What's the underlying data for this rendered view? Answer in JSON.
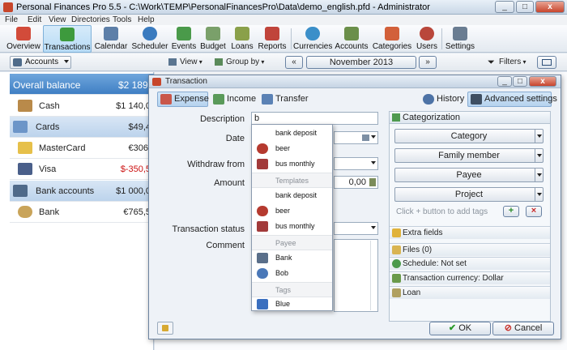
{
  "window": {
    "title": "Personal Finances Pro 5.5 - C:\\Work\\TEMP\\PersonalFinancesPro\\Data\\demo_english.pfd - Administrator",
    "min": "_",
    "max": "□",
    "close": "x"
  },
  "menu": [
    "File",
    "Edit",
    "View",
    "Directories",
    "Tools",
    "Help"
  ],
  "toolbar": [
    {
      "label": "Overview",
      "icon": "calendar-overview-icon",
      "color": "#d24b3a"
    },
    {
      "label": "Transactions",
      "icon": "transactions-book-icon",
      "color": "#3d9a3d"
    },
    {
      "label": "Calendar",
      "icon": "calendar-icon",
      "color": "#5d7fa8"
    },
    {
      "label": "Scheduler",
      "icon": "scheduler-clock-icon",
      "color": "#3a7bbf"
    },
    {
      "label": "Events",
      "icon": "events-check-icon",
      "color": "#4a9a4a"
    },
    {
      "label": "Budget",
      "icon": "budget-envelope-icon",
      "color": "#7aa06a"
    },
    {
      "label": "Loans",
      "icon": "loans-money-icon",
      "color": "#8aa04a"
    },
    {
      "label": "Reports",
      "icon": "reports-chart-icon",
      "color": "#c0443b"
    },
    {
      "label": "Currencies",
      "icon": "currencies-exchange-icon",
      "color": "#3b8fc9"
    },
    {
      "label": "Accounts",
      "icon": "accounts-cash-icon",
      "color": "#6b8f4a"
    },
    {
      "label": "Categories",
      "icon": "categories-tree-icon",
      "color": "#d2603a"
    },
    {
      "label": "Users",
      "icon": "users-icon",
      "color": "#b9473b"
    },
    {
      "label": "Settings",
      "icon": "settings-icon",
      "color": "#6a7d92"
    }
  ],
  "toolbar2": {
    "accounts": "Accounts",
    "view": "View",
    "group_by": "Group by",
    "period": "November 2013",
    "filters": "Filters"
  },
  "accounts": [
    {
      "name": "Overall balance",
      "amount": "$2 189,",
      "kind": "total"
    },
    {
      "name": "Cash",
      "amount": "$1 140,0",
      "kind": "item",
      "icon": "cash-box-icon",
      "color": "#b98a4a"
    },
    {
      "name": "Cards",
      "amount": "$49,4",
      "kind": "group",
      "icon": "cards-group-icon",
      "color": "#6c95c8"
    },
    {
      "name": "MasterCard",
      "amount": "€306,",
      "kind": "item",
      "icon": "mastercard-icon",
      "color": "#e6c04a"
    },
    {
      "name": "Visa",
      "amount": "$-350,5",
      "kind": "item",
      "negative": true,
      "icon": "visa-card-icon",
      "color": "#4a5f8a"
    },
    {
      "name": "Bank accounts",
      "amount": "$1 000,0",
      "kind": "group",
      "icon": "bank-group-icon",
      "color": "#4f6a8a"
    },
    {
      "name": "Bank",
      "amount": "€765,5",
      "kind": "item",
      "icon": "bank-coin-icon",
      "color": "#c9a45a"
    }
  ],
  "dialog": {
    "title": "Transaction",
    "tabs": {
      "expense": "Expense",
      "income": "Income",
      "transfer": "Transfer",
      "history": "History",
      "advanced": "Advanced settings"
    },
    "fields": {
      "description_label": "Description",
      "description_value": "b",
      "date_label": "Date",
      "withdraw_label": "Withdraw from",
      "amount_label": "Amount",
      "amount_value": "0,00",
      "status_label": "Transaction status",
      "comment_label": "Comment"
    },
    "categorization": {
      "title": "Categorization",
      "category": "Category",
      "family_member": "Family member",
      "payee": "Payee",
      "project": "Project",
      "tags_hint": "Click + button to add tags",
      "add": "+",
      "remove": "×"
    },
    "sections": [
      {
        "label": "Extra fields",
        "icon": "star-icon",
        "color": "#e0b23a"
      },
      {
        "label": "Files (0)",
        "icon": "folder-icon",
        "color": "#d9b451"
      },
      {
        "label": "Schedule: Not set",
        "icon": "schedule-icon",
        "color": "#4c9a4c"
      },
      {
        "label": "Transaction currency: Dollar",
        "icon": "currency-icon",
        "color": "#6a9a4a"
      },
      {
        "label": "Loan",
        "icon": "loan-icon",
        "color": "#b0a060"
      }
    ],
    "ok": "OK",
    "cancel": "Cancel"
  },
  "dropdown": [
    {
      "type": "item",
      "label": "bank deposit",
      "icon": ""
    },
    {
      "type": "item",
      "label": "beer",
      "icon": "beer-glass-icon",
      "color": "#b53a2f"
    },
    {
      "type": "item",
      "label": "bus monthly",
      "icon": "bus-ticket-icon",
      "color": "#a23a3a"
    },
    {
      "type": "header",
      "label": "Templates"
    },
    {
      "type": "item",
      "label": "bank deposit",
      "icon": ""
    },
    {
      "type": "item",
      "label": "beer",
      "icon": "beer-glass-icon",
      "color": "#b53a2f"
    },
    {
      "type": "item",
      "label": "bus monthly",
      "icon": "bus-ticket-icon",
      "color": "#a23a3a"
    },
    {
      "type": "header",
      "label": "Payee"
    },
    {
      "type": "item",
      "label": "Bank",
      "icon": "bank-building-icon",
      "color": "#5a6f8a"
    },
    {
      "type": "item",
      "label": "Bob",
      "icon": "person-icon",
      "color": "#4a78b8"
    },
    {
      "type": "header",
      "label": "Tags"
    },
    {
      "type": "item",
      "label": "Blue",
      "icon": "tag-blue-icon",
      "color": "#3a6fbf"
    }
  ]
}
